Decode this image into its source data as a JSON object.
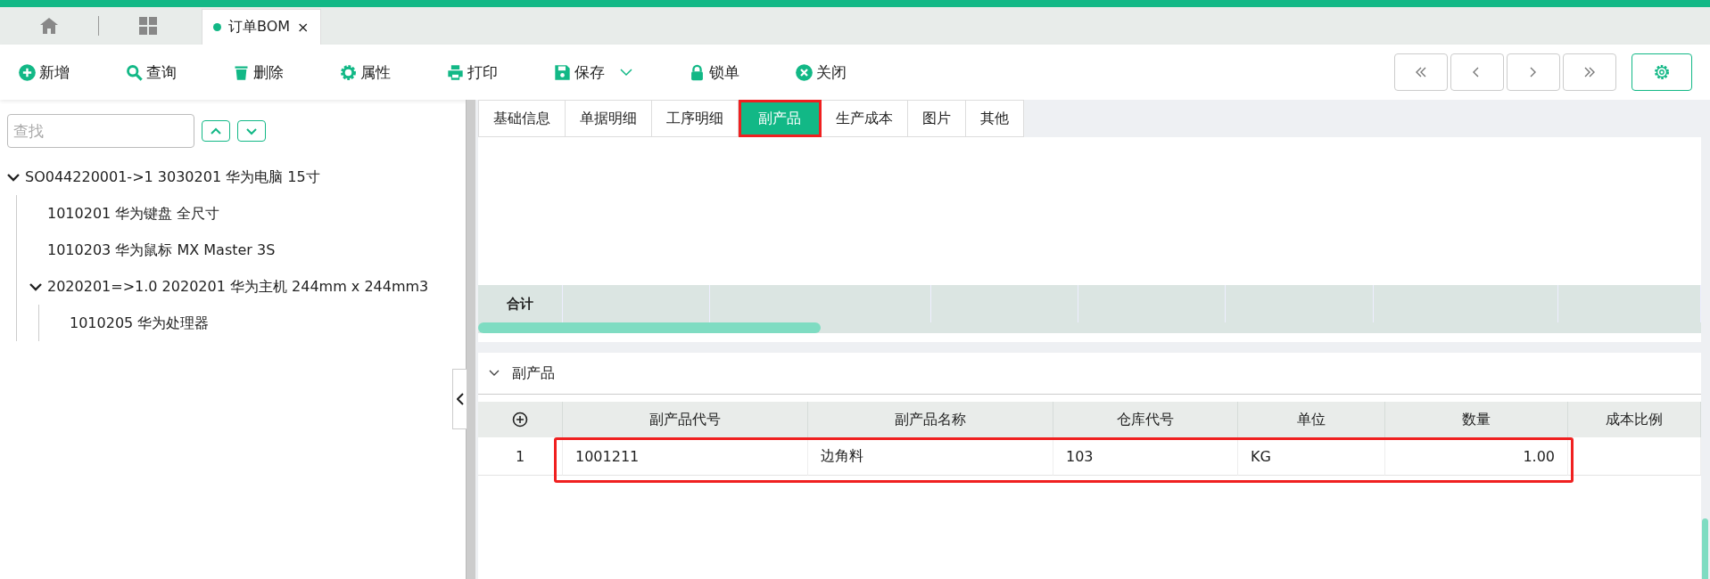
{
  "doc_tabs": [
    {
      "label": "订单BOM",
      "selected": true,
      "close": "×"
    }
  ],
  "toolbar": [
    {
      "kind": "add",
      "label": "新增"
    },
    {
      "kind": "search",
      "label": "查询"
    },
    {
      "kind": "delete",
      "label": "删除"
    },
    {
      "kind": "props",
      "label": "属性"
    },
    {
      "kind": "print",
      "label": "打印"
    },
    {
      "kind": "save",
      "label": "保存",
      "dropdown": true
    },
    {
      "kind": "lock",
      "label": "锁单"
    },
    {
      "kind": "close",
      "label": "关闭"
    }
  ],
  "tree": {
    "search": {
      "placeholder": "查找"
    },
    "items": [
      {
        "label": "SO044220001->1 3030201 华为电脑 15寸",
        "expanded": true,
        "children": [
          {
            "label": "1010201 华为键盘 全尺寸"
          },
          {
            "label": "1010203 华为鼠标 MX Master 3S"
          },
          {
            "label": "2020201=>1.0 2020201 华为主机 244mm x 244mm3",
            "expanded": true,
            "children": [
              {
                "label": "1010205 华为处理器"
              }
            ]
          }
        ]
      }
    ]
  },
  "tabs": [
    {
      "label": "基础信息",
      "selected": false
    },
    {
      "label": "单据明细",
      "selected": false
    },
    {
      "label": "工序明细",
      "selected": false
    },
    {
      "label": "副产品",
      "selected": true,
      "highlighted": true
    },
    {
      "label": "生产成本",
      "selected": false
    },
    {
      "label": "图片",
      "selected": false
    },
    {
      "label": "其他",
      "selected": false
    }
  ],
  "summary": {
    "label": "合计"
  },
  "section": {
    "title": "副产品",
    "expanded": true,
    "table": {
      "columns": [
        "副产品代号",
        "副产品名称",
        "仓库代号",
        "单位",
        "数量",
        "成本比例"
      ],
      "rows": [
        {
          "index": "1",
          "cells": [
            "1001211",
            "边角料",
            "103",
            "KG",
            "1.00"
          ],
          "highlighted": true
        }
      ]
    }
  }
}
